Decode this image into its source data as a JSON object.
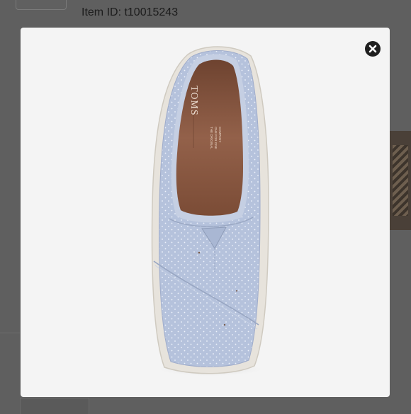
{
  "background": {
    "item_id": "Item ID: t10015243"
  },
  "modal": {
    "image": {
      "brand": "TOMS"
    },
    "close_icon": "close-icon"
  },
  "colors": {
    "overlay": "#5e5e5e",
    "modal_bg": "#f4f4f4",
    "shoe_canvas": "#b5c2dc",
    "insole": "#8b5a3e"
  }
}
